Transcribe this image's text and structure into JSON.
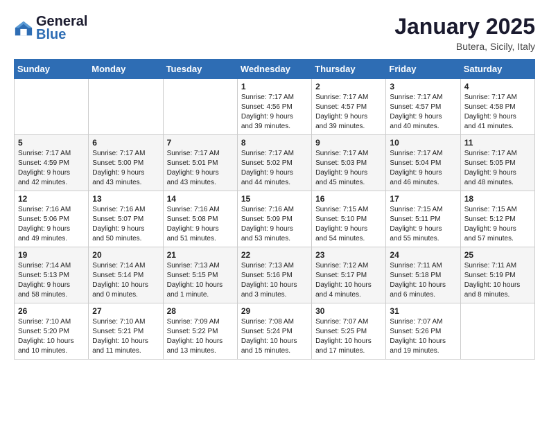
{
  "header": {
    "logo_line1": "General",
    "logo_line2": "Blue",
    "month": "January 2025",
    "location": "Butera, Sicily, Italy"
  },
  "weekdays": [
    "Sunday",
    "Monday",
    "Tuesday",
    "Wednesday",
    "Thursday",
    "Friday",
    "Saturday"
  ],
  "weeks": [
    [
      {
        "day": "",
        "info": ""
      },
      {
        "day": "",
        "info": ""
      },
      {
        "day": "",
        "info": ""
      },
      {
        "day": "1",
        "info": "Sunrise: 7:17 AM\nSunset: 4:56 PM\nDaylight: 9 hours\nand 39 minutes."
      },
      {
        "day": "2",
        "info": "Sunrise: 7:17 AM\nSunset: 4:57 PM\nDaylight: 9 hours\nand 39 minutes."
      },
      {
        "day": "3",
        "info": "Sunrise: 7:17 AM\nSunset: 4:57 PM\nDaylight: 9 hours\nand 40 minutes."
      },
      {
        "day": "4",
        "info": "Sunrise: 7:17 AM\nSunset: 4:58 PM\nDaylight: 9 hours\nand 41 minutes."
      }
    ],
    [
      {
        "day": "5",
        "info": "Sunrise: 7:17 AM\nSunset: 4:59 PM\nDaylight: 9 hours\nand 42 minutes."
      },
      {
        "day": "6",
        "info": "Sunrise: 7:17 AM\nSunset: 5:00 PM\nDaylight: 9 hours\nand 43 minutes."
      },
      {
        "day": "7",
        "info": "Sunrise: 7:17 AM\nSunset: 5:01 PM\nDaylight: 9 hours\nand 43 minutes."
      },
      {
        "day": "8",
        "info": "Sunrise: 7:17 AM\nSunset: 5:02 PM\nDaylight: 9 hours\nand 44 minutes."
      },
      {
        "day": "9",
        "info": "Sunrise: 7:17 AM\nSunset: 5:03 PM\nDaylight: 9 hours\nand 45 minutes."
      },
      {
        "day": "10",
        "info": "Sunrise: 7:17 AM\nSunset: 5:04 PM\nDaylight: 9 hours\nand 46 minutes."
      },
      {
        "day": "11",
        "info": "Sunrise: 7:17 AM\nSunset: 5:05 PM\nDaylight: 9 hours\nand 48 minutes."
      }
    ],
    [
      {
        "day": "12",
        "info": "Sunrise: 7:16 AM\nSunset: 5:06 PM\nDaylight: 9 hours\nand 49 minutes."
      },
      {
        "day": "13",
        "info": "Sunrise: 7:16 AM\nSunset: 5:07 PM\nDaylight: 9 hours\nand 50 minutes."
      },
      {
        "day": "14",
        "info": "Sunrise: 7:16 AM\nSunset: 5:08 PM\nDaylight: 9 hours\nand 51 minutes."
      },
      {
        "day": "15",
        "info": "Sunrise: 7:16 AM\nSunset: 5:09 PM\nDaylight: 9 hours\nand 53 minutes."
      },
      {
        "day": "16",
        "info": "Sunrise: 7:15 AM\nSunset: 5:10 PM\nDaylight: 9 hours\nand 54 minutes."
      },
      {
        "day": "17",
        "info": "Sunrise: 7:15 AM\nSunset: 5:11 PM\nDaylight: 9 hours\nand 55 minutes."
      },
      {
        "day": "18",
        "info": "Sunrise: 7:15 AM\nSunset: 5:12 PM\nDaylight: 9 hours\nand 57 minutes."
      }
    ],
    [
      {
        "day": "19",
        "info": "Sunrise: 7:14 AM\nSunset: 5:13 PM\nDaylight: 9 hours\nand 58 minutes."
      },
      {
        "day": "20",
        "info": "Sunrise: 7:14 AM\nSunset: 5:14 PM\nDaylight: 10 hours\nand 0 minutes."
      },
      {
        "day": "21",
        "info": "Sunrise: 7:13 AM\nSunset: 5:15 PM\nDaylight: 10 hours\nand 1 minute."
      },
      {
        "day": "22",
        "info": "Sunrise: 7:13 AM\nSunset: 5:16 PM\nDaylight: 10 hours\nand 3 minutes."
      },
      {
        "day": "23",
        "info": "Sunrise: 7:12 AM\nSunset: 5:17 PM\nDaylight: 10 hours\nand 4 minutes."
      },
      {
        "day": "24",
        "info": "Sunrise: 7:11 AM\nSunset: 5:18 PM\nDaylight: 10 hours\nand 6 minutes."
      },
      {
        "day": "25",
        "info": "Sunrise: 7:11 AM\nSunset: 5:19 PM\nDaylight: 10 hours\nand 8 minutes."
      }
    ],
    [
      {
        "day": "26",
        "info": "Sunrise: 7:10 AM\nSunset: 5:20 PM\nDaylight: 10 hours\nand 10 minutes."
      },
      {
        "day": "27",
        "info": "Sunrise: 7:10 AM\nSunset: 5:21 PM\nDaylight: 10 hours\nand 11 minutes."
      },
      {
        "day": "28",
        "info": "Sunrise: 7:09 AM\nSunset: 5:22 PM\nDaylight: 10 hours\nand 13 minutes."
      },
      {
        "day": "29",
        "info": "Sunrise: 7:08 AM\nSunset: 5:24 PM\nDaylight: 10 hours\nand 15 minutes."
      },
      {
        "day": "30",
        "info": "Sunrise: 7:07 AM\nSunset: 5:25 PM\nDaylight: 10 hours\nand 17 minutes."
      },
      {
        "day": "31",
        "info": "Sunrise: 7:07 AM\nSunset: 5:26 PM\nDaylight: 10 hours\nand 19 minutes."
      },
      {
        "day": "",
        "info": ""
      }
    ]
  ]
}
